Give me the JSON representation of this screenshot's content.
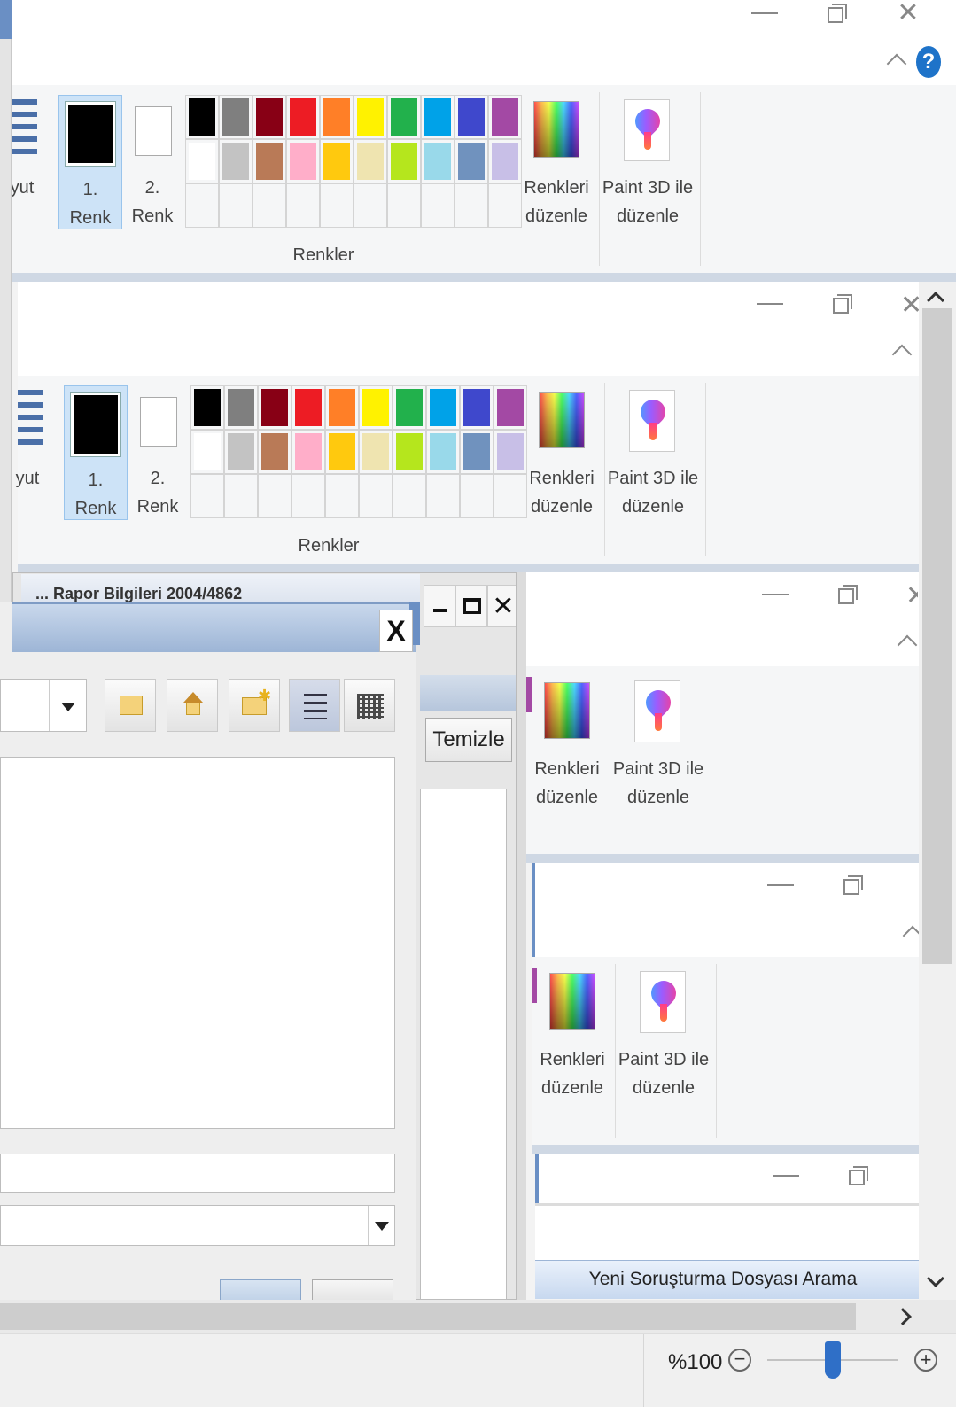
{
  "windows": [
    {
      "top": 0,
      "ribbon": {
        "color1_label": "1.\nRenk",
        "color2_label": "2.\nRenk",
        "group_label": "Renkler",
        "edit_colors_label": "Renkleri\ndüzenle",
        "paint3d_label": "Paint 3D ile\ndüzenle",
        "side_fragment": "yut"
      }
    },
    {
      "ribbon": {
        "color1_label": "1.\nRenk",
        "color2_label": "2.\nRenk",
        "group_label": "Renkler",
        "edit_colors_label": "Renkleri\ndüzenle",
        "paint3d_label": "Paint 3D ile\ndüzenle",
        "side_fragment": "yut"
      }
    }
  ],
  "small_windows": [
    {
      "edit_colors_label": "Renkleri\ndüzenle",
      "paint3d_label": "Paint 3D ile\ndüzenle"
    },
    {
      "edit_colors_label": "Renkleri\ndüzenle",
      "paint3d_label": "Paint 3D ile\ndüzenle"
    }
  ],
  "palette_colors": [
    "#000000",
    "#7f7f7f",
    "#880015",
    "#ed1c24",
    "#ff7f27",
    "#fff200",
    "#22b14c",
    "#00a2e8",
    "#3f48cc",
    "#a349a4",
    "#ffffff",
    "#c3c3c3",
    "#b97a57",
    "#ffaec9",
    "#ffc90e",
    "#efe4b0",
    "#b5e61d",
    "#99d9ea",
    "#7092be",
    "#c8bfe7"
  ],
  "dialog": {
    "close_glyph": "X",
    "clear_button": "Temizle",
    "back_window_title_fragment": "... Rapor Bilgileri 2004/4862"
  },
  "bottom_window": {
    "title": "Yeni Soruşturma Dosyası Arama"
  },
  "status": {
    "zoom": "%100",
    "zoom_out": "−",
    "zoom_in": "+",
    "zoom_fraction": 0.5
  },
  "help_icon": "?"
}
